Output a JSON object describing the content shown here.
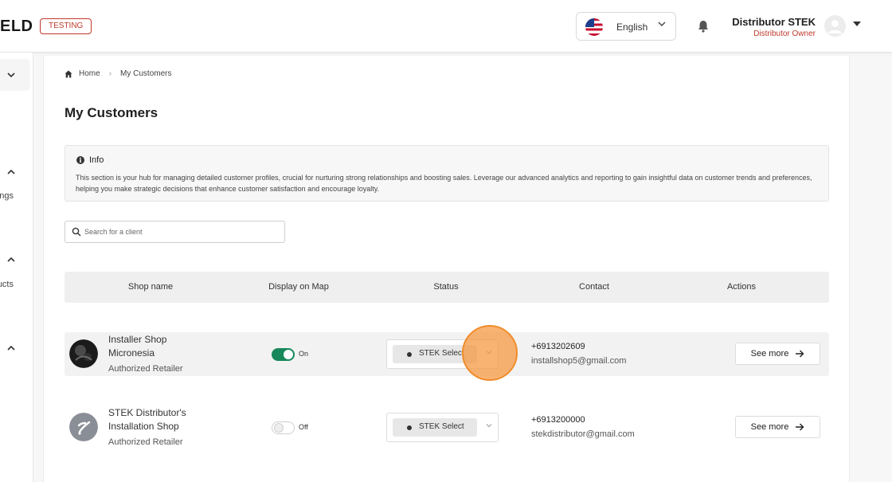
{
  "header": {
    "logo_text": "ELD",
    "env_badge": "TESTING",
    "language": {
      "label": "English",
      "flag": "us-flag-icon"
    },
    "notifications_icon": "bell-icon",
    "user": {
      "name": "Distributor STEK",
      "role": "Distributor Owner"
    }
  },
  "sidebar": {
    "items": [
      {
        "icon": "chevron-down-icon",
        "label": ""
      },
      {
        "icon": "chevron-up-icon",
        "label": "ngs"
      },
      {
        "icon": "chevron-up-icon",
        "label": "ucts"
      },
      {
        "icon": "chevron-up-icon",
        "label": ""
      }
    ]
  },
  "breadcrumb": {
    "home": "Home",
    "current": "My Customers"
  },
  "page": {
    "title": "My Customers"
  },
  "info": {
    "title": "Info",
    "text": "This section is your hub for managing detailed customer profiles, crucial for nurturing strong relationships and boosting sales. Leverage our advanced analytics and reporting to gain insightful data on customer trends and preferences, helping you make strategic decisions that enhance customer satisfaction and encourage loyalty."
  },
  "search": {
    "placeholder": "Search for a client",
    "value": ""
  },
  "table": {
    "columns": [
      "Shop name",
      "Display on Map",
      "Status",
      "Contact",
      "Actions"
    ],
    "rows": [
      {
        "name": "Installer Shop Micronesia",
        "type": "Authorized Retailer",
        "display_on_map": true,
        "display_label": "On",
        "status": "STEK Select",
        "phone": "+6913202609",
        "email": "installshop5@gmail.com",
        "action": "See more"
      },
      {
        "name": "STEK Distributor's Installation Shop",
        "type": "Authorized Retailer",
        "display_on_map": false,
        "display_label": "Off",
        "status": "STEK Select",
        "phone": "+6913200000",
        "email": "stekdistributor@gmail.com",
        "action": "See more"
      }
    ]
  },
  "colors": {
    "accent_red": "#c0392b",
    "toggle_on": "#16885a",
    "click_marker": "#f08c2a"
  }
}
